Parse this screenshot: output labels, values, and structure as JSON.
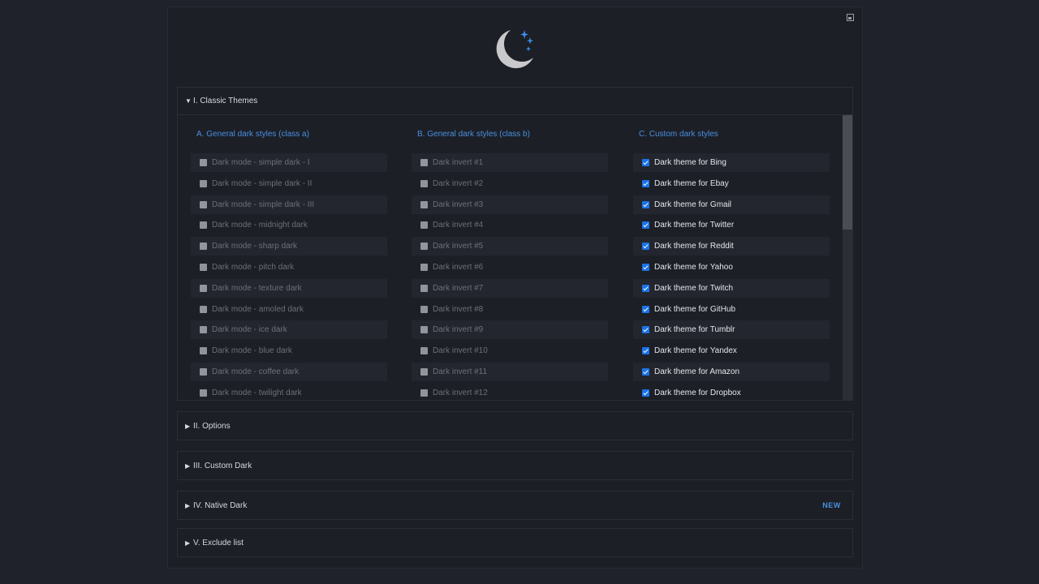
{
  "sections": {
    "classic": {
      "arrow": "▼",
      "title": "I. Classic Themes"
    },
    "options": {
      "arrow": "▶",
      "title": "II. Options"
    },
    "custom_dark": {
      "arrow": "▶",
      "title": "III. Custom Dark"
    },
    "native_dark": {
      "arrow": "▶",
      "title": "IV. Native Dark",
      "badge": "NEW"
    },
    "exclude": {
      "arrow": "▶",
      "title": "V. Exclude list"
    }
  },
  "columns": [
    {
      "title": "A. General dark styles (class a)",
      "checked": false,
      "items": [
        "Dark mode - simple dark - I",
        "Dark mode - simple dark - II",
        "Dark mode - simple dark - III",
        "Dark mode - midnight dark",
        "Dark mode - sharp dark",
        "Dark mode - pitch dark",
        "Dark mode - texture dark",
        "Dark mode - amoled dark",
        "Dark mode - ice dark",
        "Dark mode - blue dark",
        "Dark mode - coffee dark",
        "Dark mode - twilight dark"
      ]
    },
    {
      "title": "B. General dark styles (class b)",
      "checked": false,
      "items": [
        "Dark invert #1",
        "Dark invert #2",
        "Dark invert #3",
        "Dark invert #4",
        "Dark invert #5",
        "Dark invert #6",
        "Dark invert #7",
        "Dark invert #8",
        "Dark invert #9",
        "Dark invert #10",
        "Dark invert #11",
        "Dark invert #12"
      ]
    },
    {
      "title": "C. Custom dark styles",
      "checked": true,
      "items": [
        "Dark theme for Bing",
        "Dark theme for Ebay",
        "Dark theme for Gmail",
        "Dark theme for Twitter",
        "Dark theme for Reddit",
        "Dark theme for Yahoo",
        "Dark theme for Twitch",
        "Dark theme for GitHub",
        "Dark theme for Tumblr",
        "Dark theme for Yandex",
        "Dark theme for Amazon",
        "Dark theme for Dropbox"
      ]
    }
  ],
  "colors": {
    "accent": "#4a8fe0",
    "checkbox_on": "#1a73e8",
    "background": "#1f222a",
    "panel": "#1c1f26",
    "moon": "#c9c9cb",
    "stars": "#3d8ef0"
  },
  "icons": {
    "logo": "moon-stars-icon",
    "expand": "expand-window-icon"
  }
}
